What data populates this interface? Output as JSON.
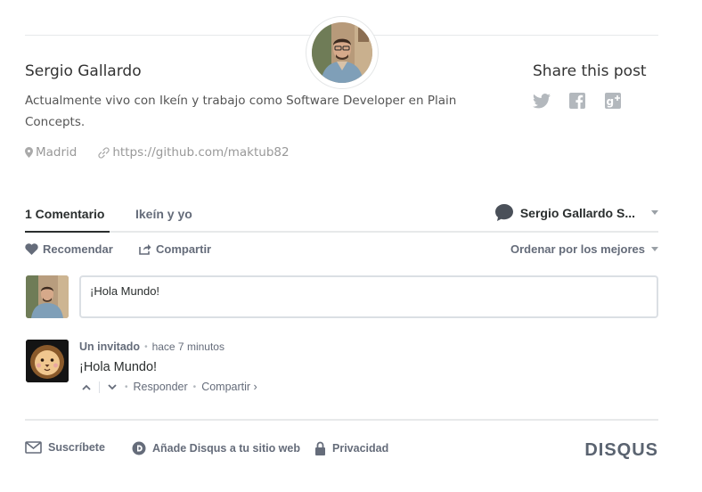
{
  "author": {
    "name": "Sergio Gallardo",
    "bio": "Actualmente vivo con Ikeín y trabajo como Software Developer en Plain Concepts.",
    "location": "Madrid",
    "website": "https://github.com/maktub82"
  },
  "share": {
    "title": "Share this post",
    "networks": [
      "twitter-icon",
      "facebook-icon",
      "google-plus-icon"
    ]
  },
  "comments": {
    "tabs": {
      "count_label": "1 Comentario",
      "community_label": "Ikeín y yo"
    },
    "user_menu": {
      "label": "Sergio Gallardo S..."
    },
    "actions": {
      "recommend": "Recomendar",
      "share": "Compartir",
      "sort": "Ordenar por los mejores"
    },
    "composer": {
      "value": "¡Hola Mundo!"
    },
    "items": [
      {
        "author": "Un invitado",
        "time": "hace 7 minutos",
        "body": "¡Hola Mundo!",
        "reply": "Responder",
        "share": "Compartir ›"
      }
    ]
  },
  "footer": {
    "subscribe": "Suscríbete",
    "add_disqus": "Añade Disqus a tu sitio web",
    "privacy": "Privacidad",
    "brand": "DISQUS"
  },
  "colors": {
    "text": "#2a2e2e",
    "muted": "#656c7a",
    "border": "#e7e9ea"
  }
}
